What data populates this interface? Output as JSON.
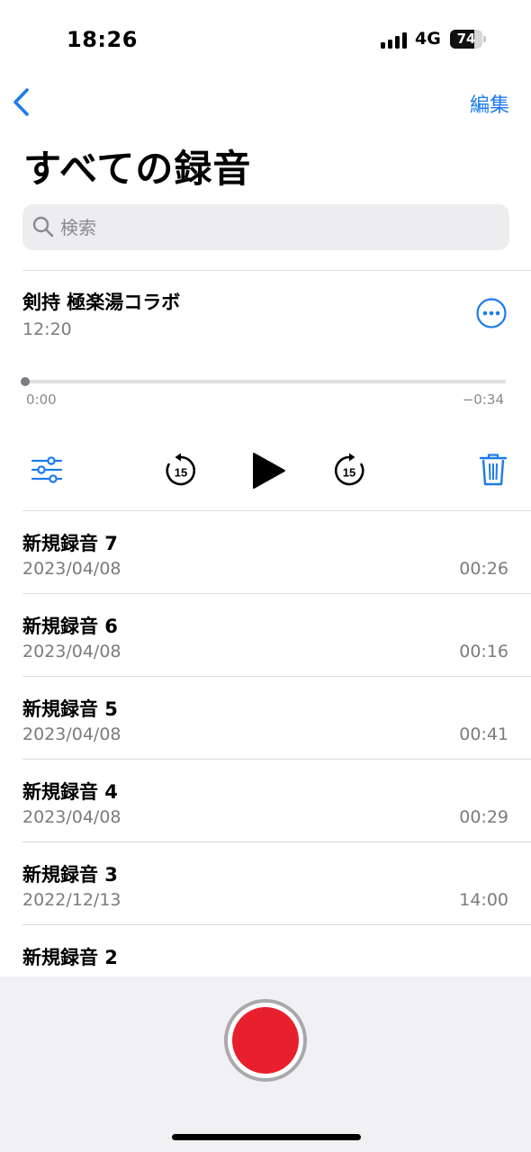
{
  "status": {
    "time": "18:26",
    "network": "4G",
    "battery": "74",
    "battery_level": 0.74
  },
  "nav": {
    "edit_label": "編集"
  },
  "title": "すべての録音",
  "search": {
    "placeholder": "検索"
  },
  "expanded": {
    "title": "剣持 極楽湯コラボ",
    "time": "12:20",
    "elapsed": "0:00",
    "remaining": "−0:34",
    "progress": 0.0,
    "skip_back": "15",
    "skip_forward": "15"
  },
  "recordings": [
    {
      "name": "新規録音 7",
      "date": "2023/04/08",
      "duration": "00:26"
    },
    {
      "name": "新規録音 6",
      "date": "2023/04/08",
      "duration": "00:16"
    },
    {
      "name": "新規録音 5",
      "date": "2023/04/08",
      "duration": "00:41"
    },
    {
      "name": "新規録音 4",
      "date": "2023/04/08",
      "duration": "00:29"
    },
    {
      "name": "新規録音 3",
      "date": "2022/12/13",
      "duration": "14:00"
    },
    {
      "name": "新規録音 2",
      "date": "",
      "duration": ""
    }
  ],
  "colors": {
    "accent": "#1e7bea",
    "record": "#e8202e",
    "secondary_text": "#7b7b80"
  },
  "icons": [
    "back-chevron-icon",
    "search-icon",
    "more-icon",
    "options-icon",
    "skip-back-15-icon",
    "play-icon",
    "skip-forward-15-icon",
    "trash-icon",
    "record-icon"
  ]
}
